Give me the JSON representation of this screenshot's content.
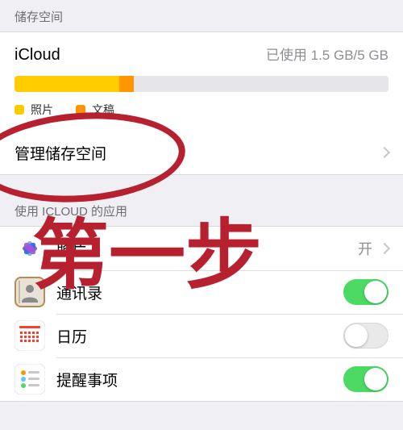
{
  "colors": {
    "photos_swatch": "#ffcc00",
    "docs_swatch": "#ff9500",
    "annotation": "#b7202e"
  },
  "sections": {
    "storage_header": "储存空间",
    "apps_header": "使用 ICLOUD 的应用"
  },
  "storage": {
    "title": "iCloud",
    "usage_text": "已使用 1.5 GB/5 GB",
    "bar_photos_pct": 28,
    "bar_docs_pct": 4,
    "legend": {
      "photos": "照片",
      "docs": "文稿"
    },
    "manage_label": "管理储存空间"
  },
  "apps": [
    {
      "key": "photos",
      "label": "照片",
      "action": "disclosure",
      "value": "开",
      "icon_bg": "#ffffff"
    },
    {
      "key": "contacts",
      "label": "通讯录",
      "action": "toggle",
      "on": true,
      "icon_bg": "#f0c078"
    },
    {
      "key": "calendar",
      "label": "日历",
      "action": "toggle",
      "on": false,
      "icon_bg": "#ffffff"
    },
    {
      "key": "reminders",
      "label": "提醒事项",
      "action": "toggle",
      "on": true,
      "icon_bg": "#ffffff"
    }
  ],
  "annotation": {
    "text": "第一步"
  }
}
